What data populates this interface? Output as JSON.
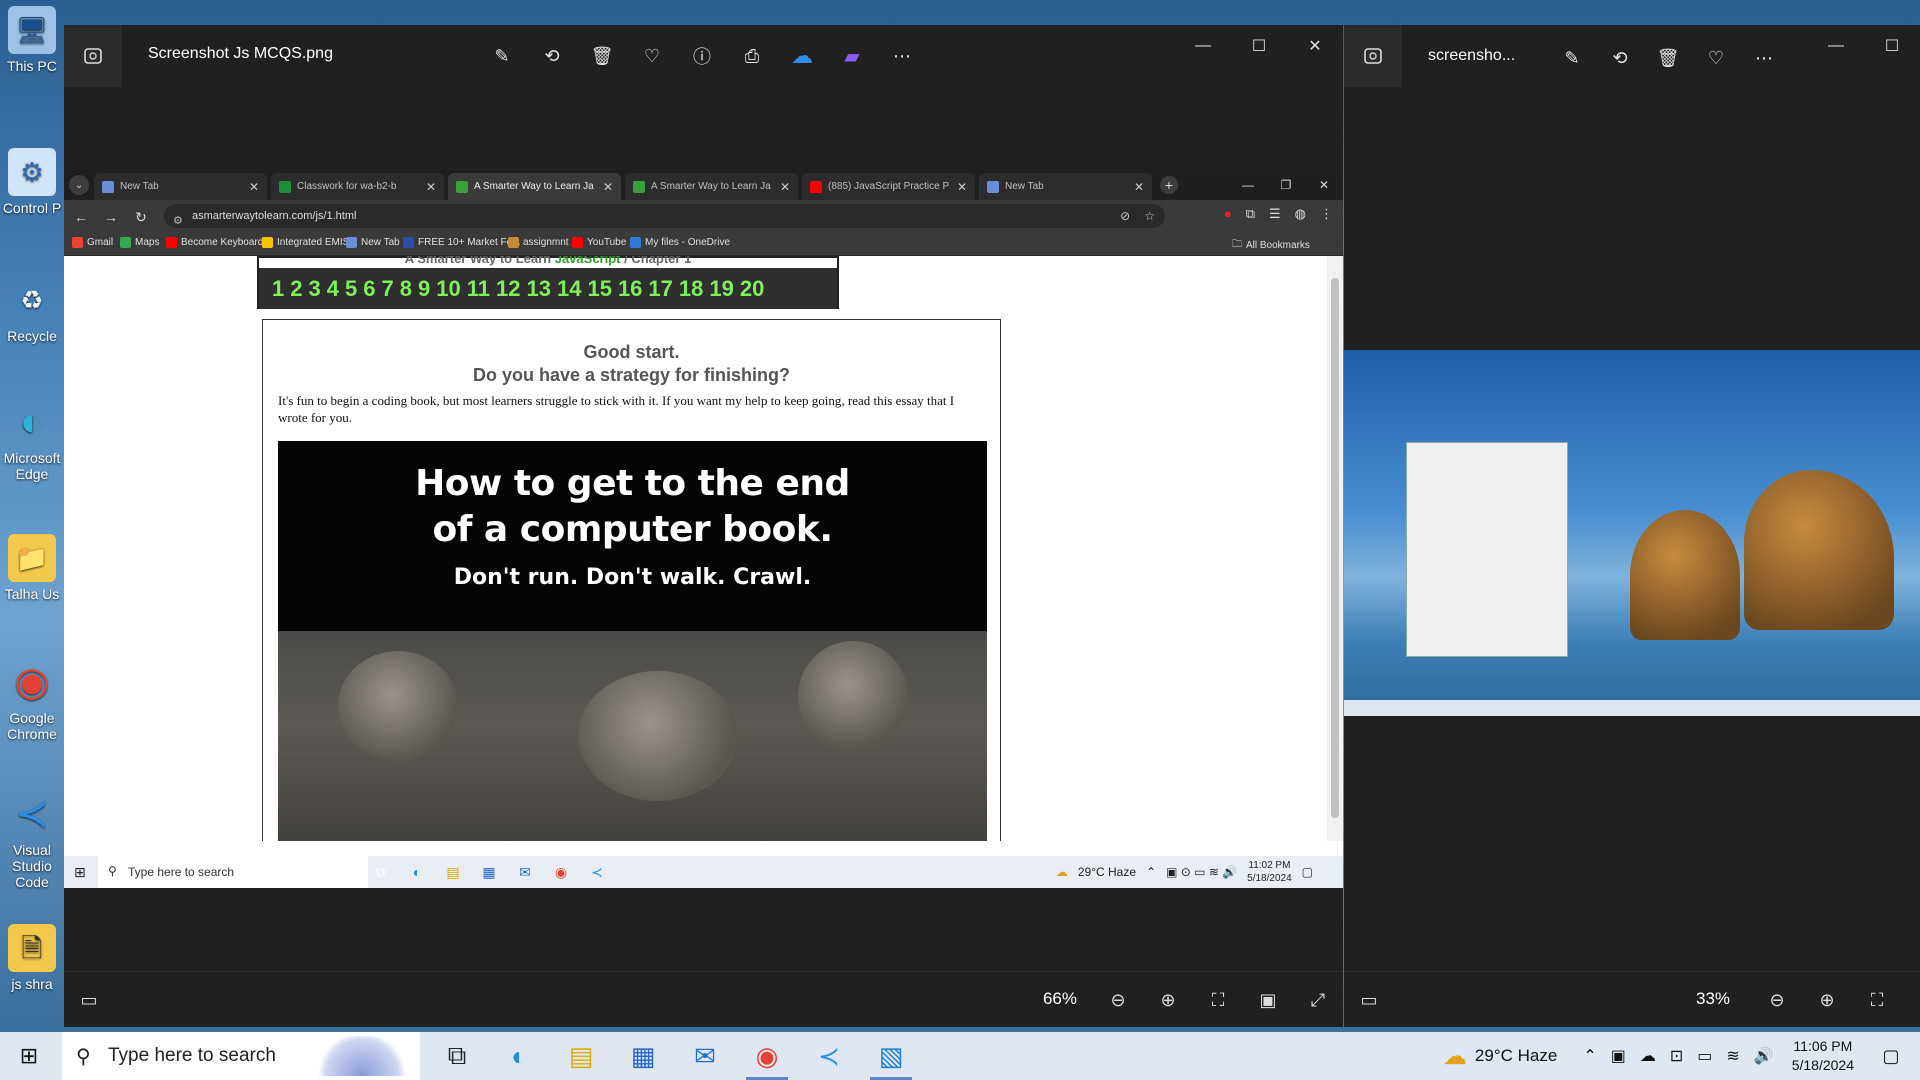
{
  "desktop": {
    "icons": [
      "This PC",
      "Control P",
      "Recycle",
      "Microsoft Edge",
      "Talha Us",
      "Google Chrome",
      "Visual Studio Code",
      "js shra"
    ]
  },
  "photos_left": {
    "title": "Screenshot Js MCQS.png",
    "zoom": "66%",
    "tools": [
      "edit-icon",
      "rotate-icon",
      "delete-icon",
      "favorite-icon",
      "info-icon",
      "print-icon",
      "onedrive-icon",
      "clipchamp-icon",
      "more-icon"
    ]
  },
  "chrome": {
    "tabs": [
      {
        "label": "New Tab",
        "fav": "#6a8fd6"
      },
      {
        "label": "Classwork for wa-b2-b",
        "fav": "#1e8e3e"
      },
      {
        "label": "A Smarter Way to Learn Ja",
        "fav": "#3aa03a"
      },
      {
        "label": "A Smarter Way to Learn Ja",
        "fav": "#3aa03a"
      },
      {
        "label": "(885) JavaScript Practice P",
        "fav": "#ff0000"
      },
      {
        "label": "New Tab",
        "fav": "#6a8fd6"
      }
    ],
    "url": "asmarterwaytolearn.com/js/1.html",
    "bookmarks": [
      {
        "label": "Gmail",
        "color": "#ea4335"
      },
      {
        "label": "Maps",
        "color": "#34a853"
      },
      {
        "label": "Become Keyboard...",
        "color": "#ff0000"
      },
      {
        "label": "Integrated EMIS",
        "color": "#f5c400"
      },
      {
        "label": "New Tab",
        "color": "#6a8fd6"
      },
      {
        "label": "FREE 10+ Market Fe...",
        "color": "#2a4fa8"
      },
      {
        "label": "assignmnt",
        "color": "#c48a3a"
      },
      {
        "label": "YouTube",
        "color": "#ff0000"
      },
      {
        "label": "My files - OneDrive",
        "color": "#2f7ad6"
      }
    ],
    "all_bookmarks": "All Bookmarks"
  },
  "page": {
    "chapter_title_prefix": "A Smarter Way to Learn ",
    "chapter_title_js": "JavaScript",
    "chapter_title_suffix": " / Chapter 1",
    "chapters": [
      "1",
      "2",
      "3",
      "4",
      "5",
      "6",
      "7",
      "8",
      "9",
      "10",
      "11",
      "12",
      "13",
      "14",
      "15",
      "16",
      "17",
      "18",
      "19",
      "20"
    ],
    "heading1": "Good start.",
    "heading2": "Do you have a strategy for finishing?",
    "paragraph": "It's fun to begin a coding book, but most learners struggle to stick with it. If you want my help to keep going, read this essay that I wrote for you.",
    "banner_line1": "How to get to the end",
    "banner_line2": "of a computer book.",
    "banner_sub": "Don't run. Don't walk. Crawl."
  },
  "inner_taskbar": {
    "search_placeholder": "Type here to search",
    "weather": "29°C  Haze",
    "time": "11:02 PM",
    "date": "5/18/2024"
  },
  "photos_right": {
    "title": "screensho...",
    "zoom": "33%"
  },
  "taskbar": {
    "search_placeholder": "Type here to search",
    "weather": "29°C  Haze",
    "time": "11:06 PM",
    "date": "5/18/2024"
  }
}
